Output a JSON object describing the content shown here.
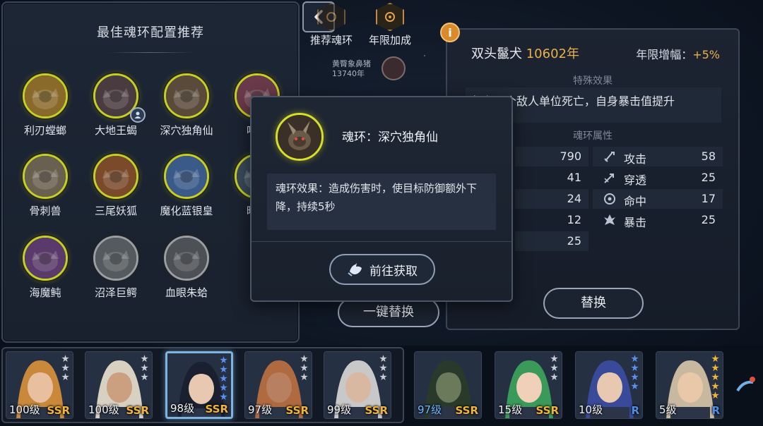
{
  "left_panel": {
    "title": "最佳魂环配置推荐",
    "rings": [
      {
        "label": "利刃螳螂",
        "color": "#8a6a2a",
        "grey": false
      },
      {
        "label": "大地王蝎",
        "color": "#4a3b40",
        "grey": false,
        "badge": "person-icon"
      },
      {
        "label": "深穴独角仙",
        "color": "#5a4a3a",
        "grey": false
      },
      {
        "label": "咆哮",
        "color": "#6a3a4a",
        "grey": false
      },
      {
        "label": "骨刺兽",
        "color": "#6a6050",
        "grey": false
      },
      {
        "label": "三尾妖狐",
        "color": "#7a4a2a",
        "grey": false
      },
      {
        "label": "魔化蓝银皇",
        "color": "#3a5a8a",
        "grey": false
      },
      {
        "label": "暗金",
        "color": "#3a4a5a",
        "grey": false
      },
      {
        "label": "海魔鲀",
        "color": "#5a3a6a",
        "grey": false
      },
      {
        "label": "沼泽巨鳄",
        "color": "#555a5e",
        "grey": true
      },
      {
        "label": "血眼朱蛤",
        "color": "#4d5054",
        "grey": true
      }
    ]
  },
  "top_tabs": [
    {
      "label": "推荐魂环",
      "icon": "soul-ring-icon"
    },
    {
      "label": "年限加成",
      "icon": "year-bonus-icon"
    }
  ],
  "small_enemy": {
    "name": "黄臀象鼻猪",
    "years": "13740年"
  },
  "right_panel": {
    "name": "双头鬣犬",
    "years": "10602年",
    "increase_label": "年限增幅：",
    "increase_value": "+5%",
    "special_title": "特殊效果",
    "special_text": "每有一个敌人单位死亡，自身暴击值提升",
    "attr_title": "魂环属性",
    "left_values": [
      "790",
      "41",
      "24",
      "12",
      "25"
    ],
    "stats": [
      {
        "name": "攻击",
        "value": "58",
        "icon": "sword-icon"
      },
      {
        "name": "穿透",
        "value": "25",
        "icon": "pierce-icon"
      },
      {
        "name": "命中",
        "value": "17",
        "icon": "target-icon"
      },
      {
        "name": "暴击",
        "value": "25",
        "icon": "crit-icon"
      }
    ],
    "replace_label": "替换"
  },
  "onekey_label": "一键替换",
  "popup": {
    "title": "魂环：深穴独角仙",
    "desc": "魂环效果：造成伤害时，使目标防御额外下降，持续5秒",
    "button_label": "前往获取"
  },
  "heroes": [
    {
      "level": "100级",
      "rarity": "SSR",
      "stars": 3,
      "star_color": "grey",
      "hair": "#c9883a",
      "skin": "#e8c0a0",
      "selected": false
    },
    {
      "level": "100级",
      "rarity": "SSR",
      "stars": 3,
      "star_color": "grey",
      "hair": "#d8d0c0",
      "skin": "#caa080",
      "selected": false
    },
    {
      "level": "98级",
      "rarity": "SSR",
      "stars": 5,
      "star_color": "blue",
      "hair": "#1a2030",
      "skin": "#e8c8b0",
      "selected": true
    },
    {
      "level": "97级",
      "rarity": "SSR",
      "stars": 3,
      "star_color": "grey",
      "hair": "#b06a40",
      "skin": "#b88060",
      "selected": false
    },
    {
      "level": "99级",
      "rarity": "SSR",
      "stars": 3,
      "star_color": "grey",
      "hair": "#c8c8c8",
      "skin": "#d8b8a0",
      "selected": false
    },
    {
      "level": "97级",
      "rarity": "SSR",
      "stars": 0,
      "star_color": "grey",
      "hair": "#2a3a2a",
      "skin": "#6a7a5a",
      "selected": false,
      "blue_level": true
    },
    {
      "level": "15级",
      "rarity": "SSR",
      "stars": 3,
      "star_color": "grey",
      "hair": "#3a9a5a",
      "skin": "#f0d0b8",
      "selected": false
    },
    {
      "level": "10级",
      "rarity": "R",
      "stars": 4,
      "star_color": "blue",
      "hair": "#3a4a9a",
      "skin": "#e8c8b0",
      "selected": false
    },
    {
      "level": "5级",
      "rarity": "R",
      "stars": 5,
      "star_color": "gold",
      "hair": "#c8b8a0",
      "skin": "#e8c8a8",
      "selected": false
    }
  ]
}
